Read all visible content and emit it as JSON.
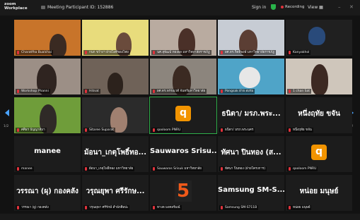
{
  "app": {
    "logo": "zoom Workplace",
    "meeting_title": "Meeting Participant ID: 152886",
    "sign_in": "Sign in",
    "recording": "Recording",
    "view": "View"
  },
  "nav": {
    "page_left": "1/2",
    "page_right": "1/2"
  },
  "tiles": [
    {
      "label": "Charatfha Bualchai"
    },
    {
      "label": "กนก ขว้างฯ ฝ่ายไอทีของไทย"
    },
    {
      "label": "นศ.สุพัฒน์ ทองผล มหาวิทยาลัยราชภัฏ"
    },
    {
      "label": "ผศ.ดร.กิตติพงษ์ มหาวิทยาลัยราชภัฏ"
    },
    {
      "label": "Kanyakhol"
    },
    {
      "label": "Workshop Phanni"
    },
    {
      "label": "Hitnat"
    },
    {
      "label": "ผศ.ดร.พรรณวดี จันทร์มหาวิทยาลัย"
    },
    {
      "label": "Pongsak ฝ่าย อบรม"
    },
    {
      "label": "1 chan Sat"
    },
    {
      "label": "ศศิธร ปัญญาสีมา"
    },
    {
      "label": "Sitaree Suparat"
    },
    {
      "label": "qooloom PNRU",
      "big": "q"
    },
    {
      "label": "ธนิตา/ มรภ.พระนคร",
      "big": "ธนิตา/ มรภ.พระ..."
    },
    {
      "label": "หนึ่งฤทัย ขจัน",
      "big": "หนึ่งฤทัย ขจัน"
    },
    {
      "label": "manee",
      "big": "manee"
    },
    {
      "label": "ผ้อนา_เกตุโพธิ์ทอง มหาวิทยาลัย",
      "big": "ม้อนา_เกตุโพธิ์ทอ..."
    },
    {
      "label": "Sauwaros Srisuk มหาวิทยาลัย",
      "big": "Sauwaros Srisu..."
    },
    {
      "label": "ทัศนา ปินทอง (ฝ่ายโครงการ)",
      "big": "ทัศนา ปินทอง (ส..."
    },
    {
      "label": "qooloom PNRU",
      "big": "q"
    },
    {
      "label": "วรรณา (ผู) กองคลัง",
      "big": "วรรณา (ผุ) กองคลัง"
    },
    {
      "label": "วรุณยุพา ศรีรักษ์ สำนักศิลปะ",
      "big": "วรุณยุพา ศรีรักษ..."
    },
    {
      "label": "ทางด มงคลร์มณ์",
      "big": "5"
    },
    {
      "label": "Samsung SM-S711B",
      "big": "Samsung SM-S..."
    },
    {
      "label": "หน่อย มนุษย์",
      "big": "หน่อย มนุษย์"
    }
  ],
  "colors": {
    "zoom_q": "#f29400",
    "active_border": "#2fae4a",
    "recording": "#e0323c",
    "nav_arrow": "#4aa3ff"
  }
}
